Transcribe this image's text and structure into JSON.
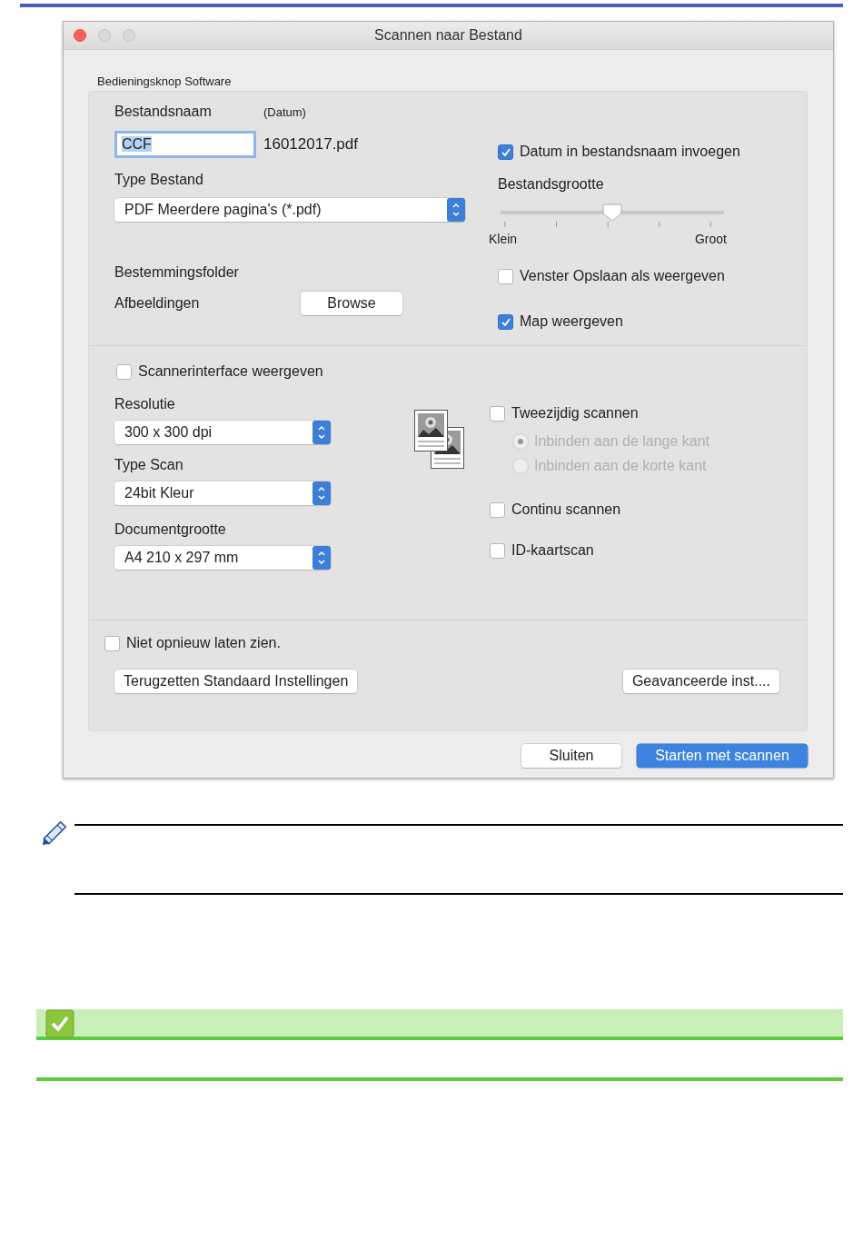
{
  "window": {
    "title": "Scannen naar Bestand"
  },
  "group_label": "Bedieningsknop Software",
  "file_name": {
    "label": "Bestandsnaam",
    "date_label": "(Datum)",
    "value": "CCF",
    "suffix": "16012017.pdf"
  },
  "file_type": {
    "label": "Type Bestand",
    "value": "PDF Meerdere pagina's (*.pdf)"
  },
  "destination": {
    "label": "Bestemmingsfolder",
    "folder": "Afbeeldingen",
    "button": "Browse"
  },
  "insert_date": {
    "label": "Datum in bestandsnaam invoegen",
    "checked": true
  },
  "file_size": {
    "label": "Bestandsgrootte",
    "level": 0.5,
    "min_label": "Klein",
    "max_label": "Groot"
  },
  "show_save_as": {
    "label": "Venster Opslaan als weergeven",
    "checked": false
  },
  "show_folder": {
    "label": "Map weergeven",
    "checked": true
  },
  "scanner_interface": {
    "label": "Scannerinterface weergeven",
    "checked": false
  },
  "resolution": {
    "label": "Resolutie",
    "value": "300 x 300 dpi"
  },
  "scan_type": {
    "label": "Type Scan",
    "value": "24bit Kleur"
  },
  "document_size": {
    "label": "Documentgrootte",
    "value": "A4 210 x 297 mm"
  },
  "duplex": {
    "label": "Tweezijdig scannen",
    "checked": false,
    "options": [
      {
        "label": "Inbinden aan de lange kant",
        "selected": true,
        "disabled": true
      },
      {
        "label": "Inbinden aan de korte kant",
        "selected": false,
        "disabled": true
      }
    ]
  },
  "continuous": {
    "label": "Continu scannen",
    "checked": false
  },
  "id_card": {
    "label": "ID-kaartscan",
    "checked": false
  },
  "dont_show_again": {
    "label": "Niet opnieuw laten zien.",
    "checked": false
  },
  "panel_buttons": {
    "reset": "Terugzetten Standaard Instellingen",
    "advanced": "Geavanceerde inst...."
  },
  "footer_buttons": [
    {
      "label": "Sluiten",
      "kind": "default"
    },
    {
      "label": "Starten met scannen",
      "kind": "primary"
    }
  ]
}
